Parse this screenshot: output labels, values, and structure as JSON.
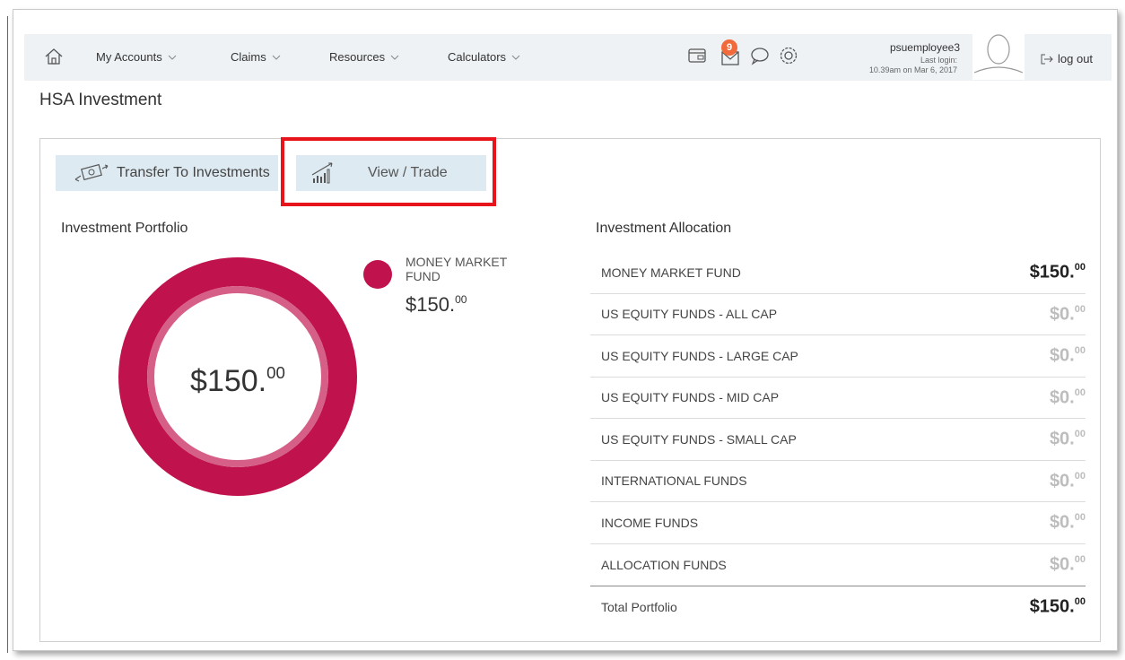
{
  "nav": {
    "items": [
      {
        "label": "My Accounts"
      },
      {
        "label": "Claims"
      },
      {
        "label": "Resources"
      },
      {
        "label": "Calculators"
      }
    ],
    "message_count": "9",
    "user_name": "psuemployee3",
    "last_login_label": "Last login:",
    "last_login_value": "10.39am on Mar 6, 2017",
    "logout_label": "log out"
  },
  "page_title": "HSA Investment",
  "actions": {
    "transfer_label": "Transfer To Investments",
    "view_trade_label": "View / Trade"
  },
  "portfolio": {
    "title": "Investment Portfolio",
    "total_main": "$150.",
    "total_cents": "00",
    "legend_label": "MONEY MARKET FUND",
    "legend_main": "$150.",
    "legend_cents": "00",
    "segment_color": "#c0134e"
  },
  "allocation": {
    "title": "Investment Allocation",
    "rows": [
      {
        "name": "MONEY MARKET FUND",
        "main": "$150.",
        "cents": "00"
      },
      {
        "name": "US EQUITY FUNDS - ALL CAP",
        "main": "$0.",
        "cents": "00"
      },
      {
        "name": "US EQUITY FUNDS - LARGE CAP",
        "main": "$0.",
        "cents": "00"
      },
      {
        "name": "US EQUITY FUNDS - MID CAP",
        "main": "$0.",
        "cents": "00"
      },
      {
        "name": "US EQUITY FUNDS - SMALL CAP",
        "main": "$0.",
        "cents": "00"
      },
      {
        "name": "INTERNATIONAL FUNDS",
        "main": "$0.",
        "cents": "00"
      },
      {
        "name": "INCOME FUNDS",
        "main": "$0.",
        "cents": "00"
      },
      {
        "name": "ALLOCATION FUNDS",
        "main": "$0.",
        "cents": "00"
      }
    ],
    "total_label": "Total Portfolio",
    "total_main": "$150.",
    "total_cents": "00"
  },
  "chart_data": {
    "type": "pie",
    "categories": [
      "MONEY MARKET FUND"
    ],
    "values": [
      150
    ]
  }
}
